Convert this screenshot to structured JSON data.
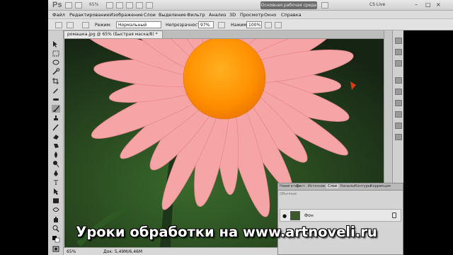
{
  "app": {
    "logo": "Ps",
    "zoom": "65%",
    "workspace": "Основная рабочая среда",
    "cs_live": "CS Live"
  },
  "menu": [
    "Файл",
    "Редактирование",
    "Изображение",
    "Слои",
    "Выделение",
    "Фильтр",
    "Анализ",
    "3D",
    "Просмотр",
    "Окно",
    "Справка"
  ],
  "options": {
    "mode_label": "Режим:",
    "mode_value": "Нормальный",
    "opacity_label": "Непрозрачность:",
    "opacity_value": "97%",
    "pressure_label": "Нажим:",
    "pressure_value": "100%"
  },
  "document": {
    "tab": "ромашка.jpg @ 65% (Быстрая маска/8) *"
  },
  "status": {
    "zoom": "65%",
    "doc": "Док: 5,49M/6,46M"
  },
  "layers_panel": {
    "tabs": [
      "Навигатор",
      "Гист.",
      "Источник",
      "Слои",
      "Каналы",
      "Контуры",
      "Коррекция"
    ],
    "blend": "Обычные",
    "layer_name": "Фон"
  },
  "caption": "Уроки обработки на www.artnoveli.ru",
  "colors": {
    "petal": "#f6a5a7",
    "center": "#ff9a00",
    "background": "#24401d"
  }
}
